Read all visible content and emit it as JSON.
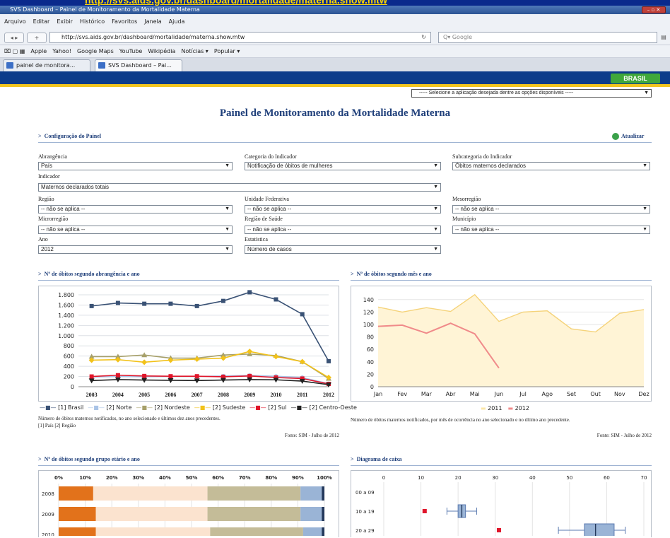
{
  "browser": {
    "banner_url": "http://svs.aids.gov.br/dashboard/mortalidade/materna.show.mtw",
    "window_title": "SVS Dashboard – Painel de Monitoramento da Mortalidade Materna",
    "menu": [
      "Arquivo",
      "Editar",
      "Exibir",
      "Histórico",
      "Favoritos",
      "Janela",
      "Ajuda"
    ],
    "url": "http://svs.aids.gov.br/dashboard/mortalidade/materna.show.mtw",
    "search_placeholder": "Google",
    "bookmarks": [
      "Apple",
      "Yahoo!",
      "Google Maps",
      "YouTube",
      "Wikipédia",
      "Notícias ▾",
      "Popular ▾"
    ],
    "tabs": [
      "painel de monitora...",
      "SVS Dashboard – Pai..."
    ]
  },
  "gov": {
    "brand": "BRASIL",
    "app_select": "----- Selecione a aplicação desejada dentre as opções disponíveis -----"
  },
  "page": {
    "title": "Painel de Monitoramento da Mortalidade Materna",
    "config_title": "Configuração do Painel",
    "refresh": "Atualizar"
  },
  "filters": {
    "abrangencia": {
      "label": "Abrangência",
      "value": "País"
    },
    "categoria": {
      "label": "Categoria do Indicador",
      "value": "Notificação de óbitos de mulheres"
    },
    "subcategoria": {
      "label": "Subcategoria do Indicador",
      "value": "Óbitos maternos declarados"
    },
    "indicador": {
      "label": "Indicador",
      "value": "Maternos declarados totais"
    },
    "regiao": {
      "label": "Região",
      "value": "-- não se aplica --"
    },
    "uf": {
      "label": "Unidade Federativa",
      "value": "-- não se aplica --"
    },
    "mesorregiao": {
      "label": "Mesorregião",
      "value": "-- não se aplica --"
    },
    "microrregiao": {
      "label": "Microrregião",
      "value": "-- não se aplica --"
    },
    "regiao_saude": {
      "label": "Região de Saúde",
      "value": "-- não se aplica --"
    },
    "municipio": {
      "label": "Município",
      "value": "-- não se aplica --"
    },
    "ano": {
      "label": "Ano",
      "value": "2012"
    },
    "estatistica": {
      "label": "Estatística",
      "value": "Número de casos"
    }
  },
  "panels": {
    "abrangencia_title": "Nº de óbitos segundo abrangência e ano",
    "abrangencia_note": "Número de óbitos maternos notificados, no ano selecionado e últimos dez anos precedentes.",
    "abrangencia_note2": "[1] País [2] Região",
    "abrangencia_source": "Fonte: SIM - Julho de 2012",
    "mes_title": "Nº de óbitos segundo mês e ano",
    "mes_note": "Número de óbitos maternos notificados, por mês de ocorrência no ano selecionado e no último ano precedente.",
    "mes_source": "Fonte: SIM - Julho de 2012",
    "etario_title": "Nº de óbitos segundo grupo etário e ano",
    "caixa_title": "Diagrama de caixa"
  },
  "chart_data": [
    {
      "type": "line",
      "xlabel": "",
      "ylabel": "",
      "x": [
        "2003",
        "2004",
        "2005",
        "2006",
        "2007",
        "2008",
        "2009",
        "2010",
        "2011",
        "2012"
      ],
      "ylim": [
        0,
        1800
      ],
      "yticks": [
        "0",
        "200",
        "400",
        "600",
        "800",
        "1.000",
        "1.200",
        "1.400",
        "1.600",
        "1.800"
      ],
      "series": [
        {
          "name": "[1] Brasil",
          "color": "#3a5275",
          "marker": "square",
          "values": [
            1580,
            1640,
            1625,
            1625,
            1580,
            1680,
            1850,
            1710,
            1420,
            500
          ]
        },
        {
          "name": "[2] Norte",
          "color": "#a9c3e6",
          "marker": "circle",
          "values": [
            190,
            200,
            195,
            200,
            200,
            210,
            220,
            205,
            180,
            60
          ]
        },
        {
          "name": "[2] Nordeste",
          "color": "#a7a06a",
          "marker": "triangle",
          "values": [
            590,
            590,
            620,
            560,
            560,
            620,
            640,
            610,
            490,
            160
          ]
        },
        {
          "name": "[2] Sudeste",
          "color": "#f2c21a",
          "marker": "diamond",
          "values": [
            520,
            530,
            480,
            520,
            540,
            560,
            690,
            590,
            490,
            180
          ]
        },
        {
          "name": "[2] Sul",
          "color": "#e0162b",
          "marker": "square",
          "values": [
            200,
            225,
            210,
            205,
            205,
            195,
            210,
            180,
            160,
            55
          ]
        },
        {
          "name": "[2] Centro-Oeste",
          "color": "#222222",
          "marker": "triangle-down",
          "values": [
            120,
            140,
            130,
            125,
            120,
            130,
            140,
            135,
            110,
            40
          ]
        }
      ]
    },
    {
      "type": "area",
      "x": [
        "Jan",
        "Fev",
        "Mar",
        "Abr",
        "Mai",
        "Jun",
        "Jul",
        "Ago",
        "Set",
        "Out",
        "Nov",
        "Dez"
      ],
      "ylim": [
        0,
        150
      ],
      "yticks": [
        "0",
        "20",
        "40",
        "60",
        "80",
        "100",
        "120",
        "140"
      ],
      "series": [
        {
          "name": "2011",
          "color": "#fbe6a8",
          "values": [
            128,
            120,
            127,
            121,
            148,
            105,
            120,
            122,
            93,
            88,
            118,
            124
          ]
        },
        {
          "name": "2012",
          "color": "#f08a8a",
          "values": [
            97,
            99,
            86,
            102,
            85,
            30,
            null,
            null,
            null,
            null,
            null,
            null
          ]
        }
      ]
    },
    {
      "type": "bar",
      "orientation": "horizontal-stacked-percent",
      "xticks": [
        "0%",
        "10%",
        "20%",
        "30%",
        "40%",
        "50%",
        "60%",
        "70%",
        "80%",
        "90%",
        "100%"
      ],
      "categories": [
        "2008",
        "2009",
        "2010"
      ],
      "series": [
        {
          "color": "#e2721b",
          "values": [
            13,
            14,
            14
          ]
        },
        {
          "color": "#fbe3cf",
          "values": [
            43,
            42,
            43
          ]
        },
        {
          "color": "#c4bc98",
          "values": [
            35,
            35,
            35
          ]
        },
        {
          "color": "#9ab4d6",
          "values": [
            8,
            8,
            7
          ]
        },
        {
          "color": "#24395c",
          "values": [
            1,
            1,
            1
          ]
        }
      ]
    },
    {
      "type": "box",
      "xticks": [
        "0",
        "10",
        "20",
        "30",
        "40",
        "50",
        "60",
        "70"
      ],
      "categories": [
        "00 a 09",
        "10 a 19",
        "20 a 29"
      ],
      "boxes": [
        {
          "category": "10 a 19",
          "whisker": [
            17,
            25
          ],
          "q1": 20,
          "median": 21,
          "q3": 22,
          "outliers": [
            11
          ]
        },
        {
          "category": "20 a 29",
          "whisker": [
            47,
            65
          ],
          "q1": 54,
          "median": 57,
          "q3": 62,
          "outliers": [
            31
          ]
        }
      ]
    }
  ]
}
